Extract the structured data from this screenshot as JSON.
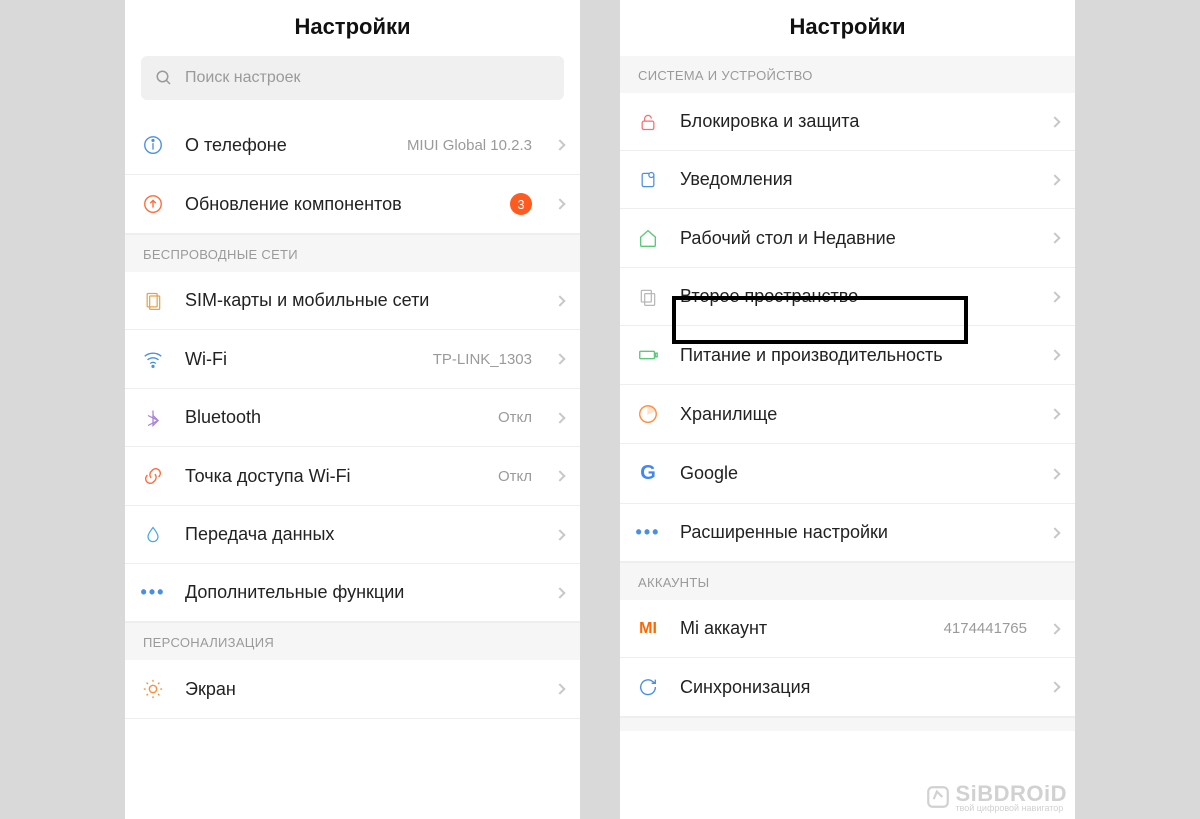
{
  "left": {
    "title": "Настройки",
    "search_placeholder": "Поиск настроек",
    "about_label": "О телефоне",
    "about_value": "MIUI Global 10.2.3",
    "update_label": "Обновление компонентов",
    "update_badge": "3",
    "sec_wireless": "БЕСПРОВОДНЫЕ СЕТИ",
    "sim_label": "SIM-карты и мобильные сети",
    "wifi_label": "Wi-Fi",
    "wifi_value": "TP-LINK_1303",
    "bt_label": "Bluetooth",
    "bt_value": "Откл",
    "hotspot_label": "Точка доступа Wi-Fi",
    "hotspot_value": "Откл",
    "data_label": "Передача данных",
    "more_label": "Дополнительные функции",
    "sec_personal": "ПЕРСОНАЛИЗАЦИЯ",
    "screen_label": "Экран"
  },
  "right": {
    "title": "Настройки",
    "sec_system": "СИСТЕМА И УСТРОЙСТВО",
    "lock_label": "Блокировка и защита",
    "notif_label": "Уведомления",
    "home_label": "Рабочий стол и Недавние",
    "second_label": "Второе пространство",
    "battery_label": "Питание и производительность",
    "storage_label": "Хранилище",
    "google_label": "Google",
    "advanced_label": "Расширенные настройки",
    "sec_accounts": "АККАУНТЫ",
    "mi_label": "Mi аккаунт",
    "mi_value": "4174441765",
    "sync_label": "Синхронизация",
    "watermark": "SiBDROiD",
    "watermark_sub": "твой цифровой навигатор"
  }
}
